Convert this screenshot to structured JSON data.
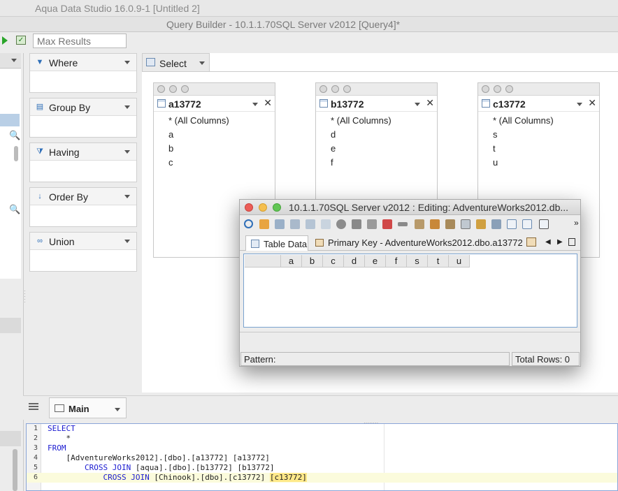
{
  "app_title": "Aqua Data Studio 16.0.9-1 [Untitled 2]",
  "window_title": "Query Builder - 10.1.1.70SQL Server v2012 [Query4]*",
  "toolbar": {
    "max_results_placeholder": "Max Results"
  },
  "clauses": {
    "where": "Where",
    "group_by": "Group By",
    "having": "Having",
    "order_by": "Order By",
    "union": "Union"
  },
  "select_tab": {
    "label": "Select"
  },
  "tables": [
    {
      "name": "a13772",
      "columns": [
        "* (All Columns)",
        "a",
        "b",
        "c"
      ]
    },
    {
      "name": "b13772",
      "columns": [
        "* (All Columns)",
        "d",
        "e",
        "f"
      ]
    },
    {
      "name": "c13772",
      "columns": [
        "* (All Columns)",
        "s",
        "t",
        "u"
      ]
    }
  ],
  "dialog": {
    "title": "10.1.1.70SQL Server v2012 : Editing: AdventureWorks2012.db...",
    "tab_table_data": "Table Data",
    "tab_primary_key": "Primary Key - AdventureWorks2012.dbo.a13772",
    "grid_columns": [
      "a",
      "b",
      "c",
      "d",
      "e",
      "f",
      "s",
      "t",
      "u"
    ],
    "pattern_label": "Pattern:",
    "total_rows": "Total Rows: 0"
  },
  "bottom": {
    "main_tab": "Main"
  },
  "editor": {
    "line_numbers": [
      "1",
      "2",
      "3",
      "4",
      "5",
      "6"
    ],
    "l1_kw": "SELECT",
    "l2": "    *",
    "l3_kw": "FROM",
    "l4": "    [AdventureWorks2012].[dbo].[a13772] [a13772]",
    "l5_indent": "        ",
    "l5_kw": "CROSS JOIN",
    "l5_rest": " [aqua].[dbo].[b13772] [b13772]",
    "l6_indent": "            ",
    "l6_kw": "CROSS JOIN",
    "l6_rest": " [Chinook].[dbo].[c13772] ",
    "l6_caret": "[c13772]"
  }
}
